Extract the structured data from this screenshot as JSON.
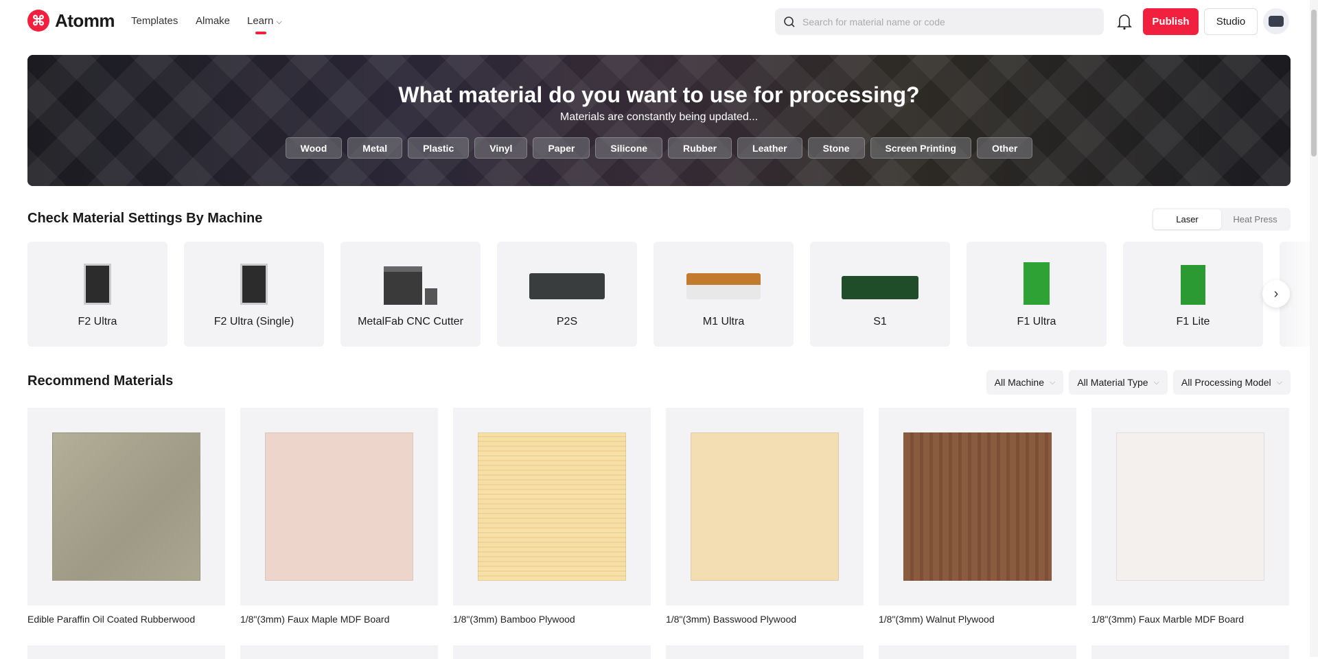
{
  "header": {
    "brand": "Atomm",
    "nav": [
      "Templates",
      "Almake",
      "Learn"
    ],
    "search_placeholder": "Search for material name or code",
    "publish": "Publish",
    "studio": "Studio"
  },
  "banner": {
    "title": "What material do you want to use for processing?",
    "subtitle": "Materials are constantly being updated...",
    "chips": [
      "Wood",
      "Metal",
      "Plastic",
      "Vinyl",
      "Paper",
      "Silicone",
      "Rubber",
      "Leather",
      "Stone",
      "Screen Printing",
      "Other"
    ]
  },
  "machines": {
    "title": "Check Material Settings By Machine",
    "toggle": [
      "Laser",
      "Heat Press"
    ],
    "items": [
      "F2 Ultra",
      "F2 Ultra (Single)",
      "MetalFab CNC Cutter",
      "P2S",
      "M1 Ultra",
      "S1",
      "F1 Ultra",
      "F1 Lite"
    ]
  },
  "recommend": {
    "title": "Recommend Materials",
    "filters": [
      "All Machine",
      "All Material Type",
      "All Processing Model"
    ],
    "items": [
      {
        "name": "Edible Paraffin Oil Coated Rubberwood",
        "color": "#a8a590"
      },
      {
        "name": "1/8\"(3mm) Faux Maple MDF Board",
        "color": "#eed5cb"
      },
      {
        "name": "1/8\"(3mm) Bamboo Plywood",
        "color": "#f7e0a8"
      },
      {
        "name": "1/8\"(3mm) Basswood Plywood",
        "color": "#f3ddb2"
      },
      {
        "name": "1/8\"(3mm) Walnut Plywood",
        "color": "#8b5b40"
      },
      {
        "name": "1/8\"(3mm) Faux Marble MDF Board",
        "color": "#f3f0ee"
      }
    ]
  },
  "colors": {
    "accent": "#f0203e"
  }
}
